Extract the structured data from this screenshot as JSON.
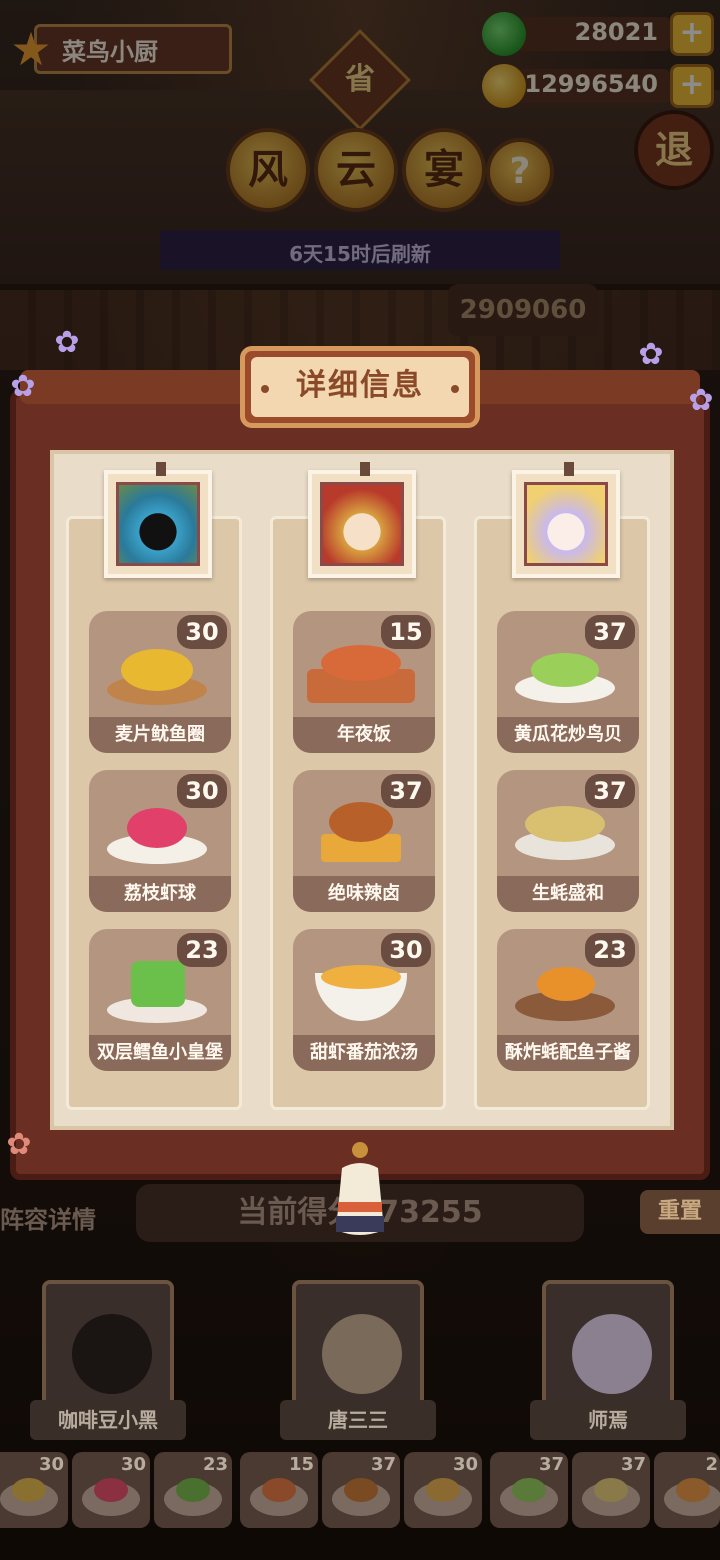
{
  "player": {
    "name": "菜鸟小厨",
    "rank_icon": "chef-rank-icon"
  },
  "currencies": {
    "jade": {
      "value": "28021",
      "icon": "jade-icon",
      "plus": "+"
    },
    "gold": {
      "value": "12996540",
      "icon": "gold-coin-icon",
      "plus": "+"
    }
  },
  "event": {
    "province_badge": "省",
    "title_chars": [
      "风",
      "云",
      "宴"
    ],
    "help": "?",
    "exit": "退",
    "refresh_text": "6天15时后刷新",
    "score_partial": "2909",
    "score_obscured": "060"
  },
  "panel": {
    "title": "详细信息",
    "columns": [
      {
        "chef": "咖啡豆小黑",
        "dishes": [
          {
            "name": "麦片鱿鱼圈",
            "level": "30",
            "color": "#e8b830"
          },
          {
            "name": "荔枝虾球",
            "level": "30",
            "color": "#e0406a"
          },
          {
            "name": "双层鳕鱼小皇堡",
            "level": "23",
            "color": "#6ac04a"
          }
        ]
      },
      {
        "chef": "唐三三",
        "dishes": [
          {
            "name": "年夜饭",
            "level": "15",
            "color": "#d86a3a"
          },
          {
            "name": "绝味辣卤",
            "level": "37",
            "color": "#b8602a"
          },
          {
            "name": "甜虾番茄浓汤",
            "level": "30",
            "color": "#f0b040"
          }
        ]
      },
      {
        "chef": "师焉",
        "dishes": [
          {
            "name": "黄瓜花炒鸟贝",
            "level": "37",
            "color": "#9ad05a"
          },
          {
            "name": "生蚝盛和",
            "level": "37",
            "color": "#d8c070"
          },
          {
            "name": "酥炸蚝配鱼子酱",
            "level": "23",
            "color": "#e8902a"
          }
        ]
      }
    ]
  },
  "bottom": {
    "lineup_label": "阵容详情",
    "current_score": "当前得分573255",
    "reset": "重置",
    "chefs": [
      "咖啡豆小黑",
      "唐三三",
      "师焉"
    ],
    "mini_dishes": [
      {
        "level": "30",
        "color": "#e8b830"
      },
      {
        "level": "30",
        "color": "#e0406a"
      },
      {
        "level": "23",
        "color": "#6ac04a"
      },
      {
        "level": "15",
        "color": "#d86a3a"
      },
      {
        "level": "37",
        "color": "#b8602a"
      },
      {
        "level": "30",
        "color": "#f0b040"
      },
      {
        "level": "37",
        "color": "#9ad05a"
      },
      {
        "level": "37",
        "color": "#d8c070"
      },
      {
        "level": "2",
        "color": "#e8902a"
      }
    ]
  }
}
